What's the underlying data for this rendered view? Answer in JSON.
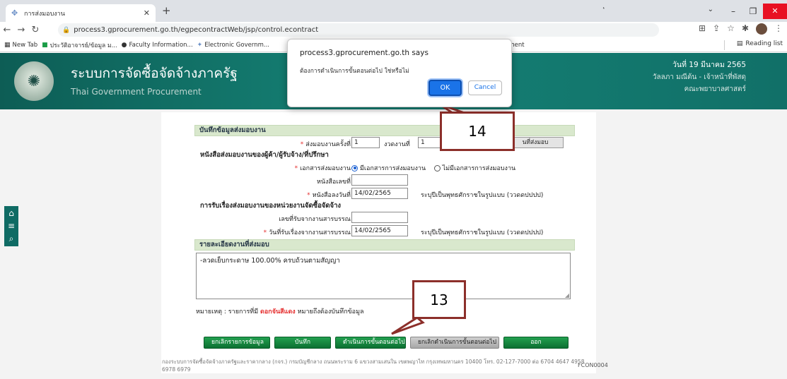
{
  "browser": {
    "tab_title": "การส่งมอบงาน",
    "url": "process3.gprocurement.go.th/egpecontractWeb/jsp/control.econtract",
    "corner_mark": "ุ",
    "bookmarks": [
      {
        "icon": "▦",
        "label": "New Tab"
      },
      {
        "icon": "■",
        "label": "ประวัติอาจารย์/ข้อมูล ม..."
      },
      {
        "icon": "●",
        "label": "Faculty Information..."
      },
      {
        "icon": "✦",
        "label": "Electronic Governm..."
      }
    ],
    "bookmark_partial": "ument",
    "reading_list": "Reading list"
  },
  "site": {
    "title_th": "ระบบการจัดซื้อจัดจ้างภาครัฐ",
    "title_en": "Thai Government Procurement",
    "date": "วันที่ 19 มีนาคม 2565",
    "user": "วัลลภา มณีต้น - เจ้าหน้าที่พัสดุ",
    "org": "คณะพยาบาลศาสตร์"
  },
  "form": {
    "section_title": "บันทึกข้อมูลส่งมอบงาน",
    "delivery_no_label": "ส่งมอบงานครั้งที่",
    "delivery_no_value": "1",
    "installment_label": "งวดงานที่",
    "installment_value": "1",
    "delivery_btn_label": "นที่ส่งมอบ",
    "vendor_doc_head": "หนังสือส่งมอบงานของผู้ค้า/ผู้รับจ้าง/ที่ปรึกษา",
    "doc_label": "เอกสารส่งมอบงาน",
    "radio_yes": "มีเอกสารการส่งมอบงาน",
    "radio_no": "ไม่มีเอกสารการส่งมอบงาน",
    "letter_no_label": "หนังสือเลขที่",
    "letter_no_value": "",
    "letter_date_label": "หนังสือลงวันที่",
    "letter_date_value": "14/02/2565",
    "date_hint": "ระบุปีเป็นพุทธศักราชในรูปแบบ (ววดดปปปป)",
    "receive_head": "การรับเรื่องส่งมอบงานของหน่วยงานจัดซื้อจัดจ้าง",
    "receipt_no_label": "เลขที่รับจากงานสารบรรณ",
    "receipt_no_value": "",
    "receipt_date_label": "วันที่รับเรื่องจากงานสารบรรณ",
    "receipt_date_value": "14/02/2565",
    "details_head": "รายละเอียดงานที่ส่งมอบ",
    "details_text": "-ลวดเย็บกระดาษ 100.00% ครบถ้วนตามสัญญา",
    "note_prefix": "หมายเหตุ : รายการที่มี",
    "note_red": "ดอกจันสีแดง",
    "note_suffix": "หมายถึงต้องบันทึกข้อมูล"
  },
  "buttons": {
    "cancel_items": "ยกเลิกรายการข้อมูล",
    "save": "บันทึก",
    "next_step": "ดำเนินการขั้นตอนต่อไป",
    "cancel_next": "ยกเลิกดำเนินการขั้นตอนต่อไป",
    "exit": "ออก"
  },
  "footer": {
    "text": "กองระบบการจัดซื้อจัดจ้างภาครัฐและราคากลาง (กจร.) กรมบัญชีกลาง ถนนพระราม 6 แขวงสามเสนใน เขตพญาไท กรุงเทพมหานคร 10400 โทร. 02-127-7000 ต่อ 6704 4647 4958 6978 6979",
    "form_code": "FCON0004"
  },
  "dialog": {
    "title": "process3.gprocurement.go.th says",
    "message": "ต้องการดำเนินการขั้นตอนต่อไป ใช่หรือไม่",
    "ok": "OK",
    "cancel": "Cancel"
  },
  "callouts": {
    "step_14": "14",
    "step_13": "13"
  }
}
